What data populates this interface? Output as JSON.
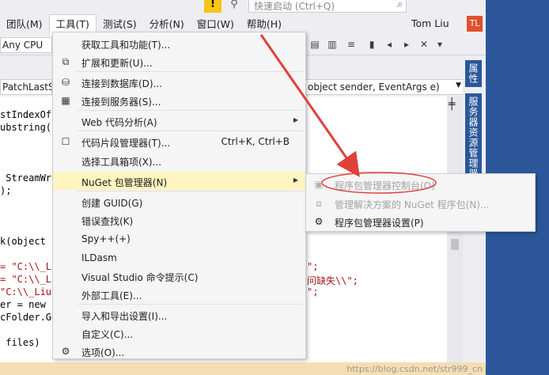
{
  "title_area": {
    "quick_launch_placeholder": "快速启动 (Ctrl+Q)",
    "feedback_icon": "!",
    "filter_icon": "⚲"
  },
  "menubar": {
    "items": [
      {
        "label": "团队(M)"
      },
      {
        "label": "工具(T)"
      },
      {
        "label": "测试(S)"
      },
      {
        "label": "分析(N)"
      },
      {
        "label": "窗口(W)"
      },
      {
        "label": "帮助(H)"
      }
    ],
    "user": "Tom Liu",
    "avatar": "TL"
  },
  "toolbar": {
    "cpu": "Any CPU"
  },
  "nav": {
    "left": "PatchLastSe",
    "right": "object sender, EventArgs e)"
  },
  "side_tabs": [
    "属性",
    "服务器资源管理器"
  ],
  "code": {
    "l1": "stIndexOf",
    "l2": "ubstring((",
    "l3": " StreamWri",
    "l4": ");",
    "l5": "k(object s",
    "l6": "= \"C:\\\\_Li",
    "l6b": "\";",
    "l7": "= \"C:\\\\_Li",
    "l7b": "问缺失\\\\\";",
    "l8": "\"C:\\\\_Liu",
    "l8b": "\";",
    "l9": "er = new I",
    "l10": "cFolder.Ge",
    "l11": " files)"
  },
  "tools_menu": {
    "items": [
      {
        "label": "获取工具和功能(T)...",
        "shortcut": "",
        "icon": ""
      },
      {
        "label": "扩展和更新(U)...",
        "shortcut": "",
        "icon": "extensions-icon"
      },
      {
        "label": "连接到数据库(D)...",
        "shortcut": "",
        "icon": "database-icon"
      },
      {
        "label": "连接到服务器(S)...",
        "shortcut": "",
        "icon": "server-icon"
      },
      {
        "label": "Web 代码分析(A)",
        "shortcut": "",
        "icon": ""
      },
      {
        "label": "代码片段管理器(T)...",
        "shortcut": "Ctrl+K, Ctrl+B",
        "icon": "checkbox-icon"
      },
      {
        "label": "选择工具箱项(X)...",
        "shortcut": "",
        "icon": ""
      },
      {
        "label": "NuGet 包管理器(N)",
        "shortcut": "",
        "icon": ""
      },
      {
        "label": "创建 GUID(G)",
        "shortcut": "",
        "icon": ""
      },
      {
        "label": "错误查找(K)",
        "shortcut": "",
        "icon": ""
      },
      {
        "label": "Spy++(+)",
        "shortcut": "",
        "icon": ""
      },
      {
        "label": "ILDasm",
        "shortcut": "",
        "icon": ""
      },
      {
        "label": "Visual Studio 命令提示(C)",
        "shortcut": "",
        "icon": ""
      },
      {
        "label": "外部工具(E)...",
        "shortcut": "",
        "icon": ""
      },
      {
        "label": "导入和导出设置(I)...",
        "shortcut": "",
        "icon": ""
      },
      {
        "label": "自定义(C)...",
        "shortcut": "",
        "icon": ""
      },
      {
        "label": "选项(O)...",
        "shortcut": "",
        "icon": "gear-icon"
      }
    ]
  },
  "nuget_menu": {
    "items": [
      {
        "label": "程序包管理器控制台(O)",
        "icon": "console-icon",
        "enabled": false
      },
      {
        "label": "管理解决方案的 NuGet 程序包(N)...",
        "icon": "package-icon",
        "enabled": false
      },
      {
        "label": "程序包管理器设置(P)",
        "icon": "gear-icon",
        "enabled": true
      }
    ]
  },
  "status": {
    "watermark": "https://blog.csdn.net/str999_cn"
  },
  "colors": {
    "highlight": "#fdf4bf",
    "annotation": "#e0403a",
    "frame": "#2b579a"
  }
}
